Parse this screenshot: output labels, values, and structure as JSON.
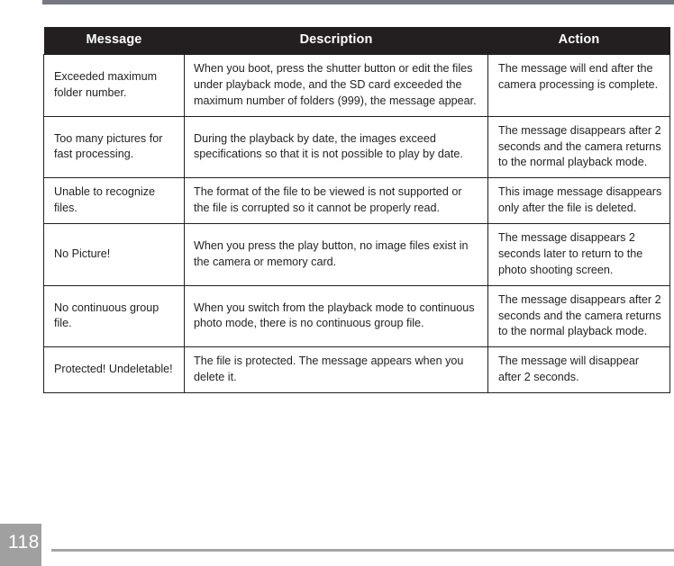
{
  "page": {
    "number": "118"
  },
  "table": {
    "headers": {
      "message": "Message",
      "description": "Description",
      "action": "Action"
    },
    "rows": [
      {
        "message": "Exceeded maximum folder number.",
        "description": "When you boot, press the shutter button or edit the files under playback mode, and the SD card exceeded the maximum number of folders (999), the message appear.",
        "action": "The message will end after the camera processing is complete."
      },
      {
        "message": "Too many pictures for fast processing.",
        "description": "During the playback by date, the images exceed specifications so that it is not possible to play by date.",
        "action": "The message disappears after 2 seconds and the camera returns to the normal playback mode."
      },
      {
        "message": "Unable to recognize files.",
        "description": "The format of the file to be viewed is not supported or the file is corrupted so it cannot be properly read.",
        "action": "This image message disappears only after the file is deleted."
      },
      {
        "message": "No Picture!",
        "description": "When you press the play button, no image files exist in the camera or memory card.",
        "action": "The message disappears 2 seconds later to return to the photo shooting screen."
      },
      {
        "message": "No continuous group file.",
        "description": "When you switch from the playback mode to continuous photo mode, there is no continuous group file.",
        "action": "The message disappears after 2 seconds and the camera returns to the normal playback mode."
      },
      {
        "message": "Protected! Undeletable!",
        "description": "The file is protected. The message appears when you delete it.",
        "action": "The message will disappear after 2 seconds."
      }
    ]
  },
  "decor": {
    "top_rule_color": "#767880",
    "footer_rule_color": "#a6a6a6",
    "page_box_color": "#a0a0a0",
    "header_bg_color": "#231f20"
  }
}
